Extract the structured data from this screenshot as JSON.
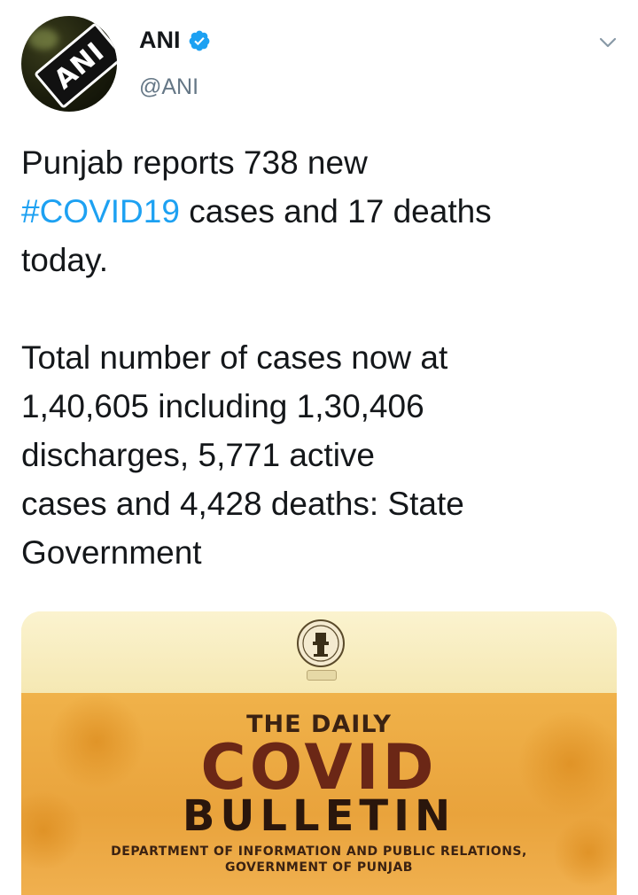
{
  "author": {
    "display_name": "ANI",
    "handle": "@ANI",
    "avatar_text": "ANI",
    "verified": true,
    "verified_color": "#1da1f2"
  },
  "tweet": {
    "line1_prefix": "Punjab reports 738 new\n",
    "hashtag": "#COVID19",
    "line1_suffix": " cases and 17 deaths\ntoday.\n\nTotal number of cases now at\n1,40,605 including 1,30,406\ndischarges, 5,771 active\ncases and 4,428 deaths: State\nGovernment",
    "hashtag_color": "#1da1f2"
  },
  "media": {
    "title_small": "THE DAILY",
    "title_big": "COVID",
    "title_bulletin": "BULLETIN",
    "department_line1": "DEPARTMENT OF INFORMATION AND PUBLIC RELATIONS,",
    "department_line2": "GOVERNMENT OF PUNJAB",
    "band_color": "#e9a33c"
  },
  "icons": {
    "verified": "verified-badge-icon",
    "menu": "chevron-down-icon",
    "seal": "government-seal-icon"
  }
}
